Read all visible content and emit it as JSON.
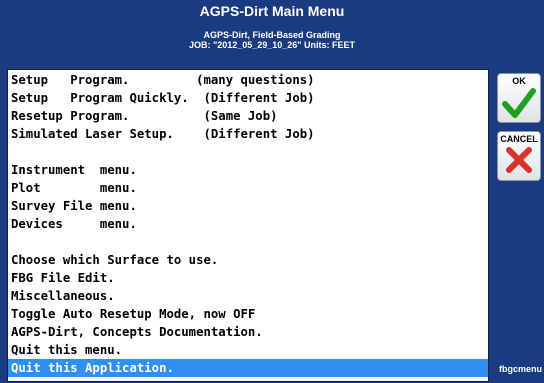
{
  "header": {
    "title": "AGPS-Dirt  Main Menu",
    "subtitle_line1": "AGPS-Dirt, Field-Based Grading",
    "subtitle_line2": "JOB: \"2012_05_29_10_26\"  Units: FEET"
  },
  "menu": {
    "items": [
      {
        "label": "Setup   Program.         (many questions)",
        "selected": false
      },
      {
        "label": "Setup   Program Quickly.  (Different Job)",
        "selected": false
      },
      {
        "label": "Resetup Program.          (Same Job)",
        "selected": false
      },
      {
        "label": "Simulated Laser Setup.    (Different Job)",
        "selected": false
      },
      {
        "label": "",
        "selected": false
      },
      {
        "label": "Instrument  menu.",
        "selected": false
      },
      {
        "label": "Plot        menu.",
        "selected": false
      },
      {
        "label": "Survey File menu.",
        "selected": false
      },
      {
        "label": "Devices     menu.",
        "selected": false
      },
      {
        "label": "",
        "selected": false
      },
      {
        "label": "Choose which Surface to use.",
        "selected": false
      },
      {
        "label": "FBG File Edit.",
        "selected": false
      },
      {
        "label": "Miscellaneous.",
        "selected": false
      },
      {
        "label": "Toggle Auto Resetup Mode, now OFF",
        "selected": false
      },
      {
        "label": "AGPS-Dirt, Concepts Documentation.",
        "selected": false
      },
      {
        "label": "Quit this menu.",
        "selected": false
      },
      {
        "label": "Quit this Application.",
        "selected": true
      }
    ]
  },
  "buttons": {
    "ok_label": "OK",
    "ok_icon": "checkmark-icon",
    "cancel_label": "CANCEL",
    "cancel_icon": "x-icon"
  },
  "footer": {
    "screen_id": "fbgcmenu"
  },
  "colors": {
    "background": "#1a3b7f",
    "selection": "#2f8ff2",
    "check_green": "#1fa01f",
    "cancel_red": "#d9322a"
  }
}
